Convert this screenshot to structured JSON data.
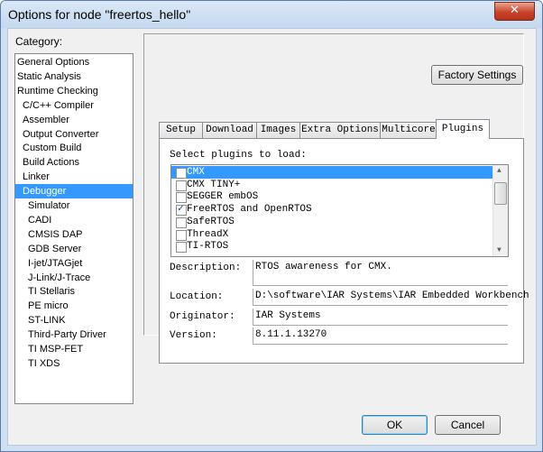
{
  "window": {
    "title": "Options for node \"freertos_hello\"",
    "close_glyph": "✕"
  },
  "category": {
    "label": "Category:",
    "items": [
      {
        "label": "General Options",
        "level": 0
      },
      {
        "label": "Static Analysis",
        "level": 0
      },
      {
        "label": "Runtime Checking",
        "level": 0
      },
      {
        "label": "C/C++ Compiler",
        "level": 1
      },
      {
        "label": "Assembler",
        "level": 1
      },
      {
        "label": "Output Converter",
        "level": 1
      },
      {
        "label": "Custom Build",
        "level": 1
      },
      {
        "label": "Build Actions",
        "level": 1
      },
      {
        "label": "Linker",
        "level": 1
      },
      {
        "label": "Debugger",
        "level": 1,
        "selected": true
      },
      {
        "label": "Simulator",
        "level": 2
      },
      {
        "label": "CADI",
        "level": 2
      },
      {
        "label": "CMSIS DAP",
        "level": 2
      },
      {
        "label": "GDB Server",
        "level": 2
      },
      {
        "label": "I-jet/JTAGjet",
        "level": 2
      },
      {
        "label": "J-Link/J-Trace",
        "level": 2
      },
      {
        "label": "TI Stellaris",
        "level": 2
      },
      {
        "label": "PE micro",
        "level": 2
      },
      {
        "label": "ST-LINK",
        "level": 2
      },
      {
        "label": "Third-Party Driver",
        "level": 2
      },
      {
        "label": "TI MSP-FET",
        "level": 2
      },
      {
        "label": "TI XDS",
        "level": 2
      }
    ]
  },
  "factory_settings_label": "Factory Settings",
  "tabs": [
    {
      "label": "Setup"
    },
    {
      "label": "Download"
    },
    {
      "label": "Images"
    },
    {
      "label": "Extra Options"
    },
    {
      "label": "Multicore"
    },
    {
      "label": "Plugins",
      "active": true
    }
  ],
  "plugins": {
    "prompt": "Select plugins to load:",
    "items": [
      {
        "label": "CMX",
        "checked": false,
        "selected": true
      },
      {
        "label": "CMX TINY+",
        "checked": false
      },
      {
        "label": "SEGGER embOS",
        "checked": false
      },
      {
        "label": "FreeRTOS and OpenRTOS",
        "checked": true
      },
      {
        "label": "SafeRTOS",
        "checked": false
      },
      {
        "label": "ThreadX",
        "checked": false
      },
      {
        "label": "TI-RTOS",
        "checked": false
      }
    ],
    "check_glyph": "✓",
    "description_label": "Description:",
    "description": "RTOS awareness for CMX.",
    "location_label": "Location:",
    "location": "D:\\software\\IAR Systems\\IAR Embedded Workbench",
    "originator_label": "Originator:",
    "originator": "IAR Systems",
    "version_label": "Version:",
    "version": "8.11.1.13270"
  },
  "buttons": {
    "ok": "OK",
    "cancel": "Cancel"
  }
}
